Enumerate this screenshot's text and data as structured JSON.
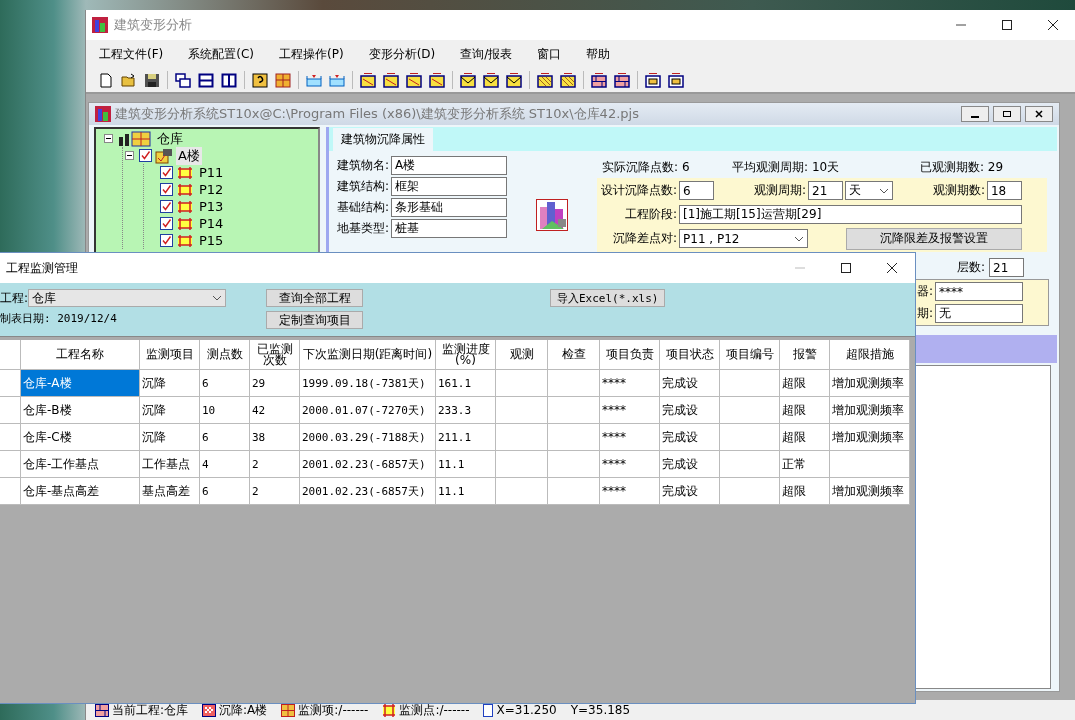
{
  "main_window": {
    "title": "建筑变形分析",
    "menu": [
      "工程文件(F)",
      "系统配置(C)",
      "工程操作(P)",
      "变形分析(D)",
      "查询/报表",
      "窗口",
      "帮助"
    ],
    "status_bar": [
      {
        "kind": "project",
        "text": "当前工程:仓库"
      },
      {
        "kind": "building",
        "text": "沉降:A楼"
      },
      {
        "kind": "item",
        "text": "监测项:/------"
      },
      {
        "kind": "point",
        "text": "监测点:/------"
      },
      {
        "kind": "coord",
        "text": "X=31.250"
      },
      {
        "kind": "none",
        "text": "Y=35.185"
      }
    ]
  },
  "child_window": {
    "title": "建筑变形分析系统ST10x@C:\\Program Files (x86)\\建筑变形分析系统 ST10x\\仓库42.pjs",
    "tree": {
      "label": "仓库",
      "expanded": true,
      "selected": false,
      "children": [
        {
          "label": "A楼",
          "checked": true,
          "expanded": true,
          "selected": true,
          "children": [
            {
              "label": "P11",
              "checked": true,
              "selected": false
            },
            {
              "label": "P12",
              "checked": true,
              "selected": false
            },
            {
              "label": "P13",
              "checked": true,
              "selected": false
            },
            {
              "label": "P14",
              "checked": true,
              "selected": false
            },
            {
              "label": "P15",
              "checked": true,
              "selected": false
            }
          ]
        }
      ]
    },
    "tab": {
      "label": "建筑物沉降属性",
      "selected": true
    },
    "fields": [
      {
        "label": "建筑物名:",
        "value": "A楼"
      },
      {
        "label": "建筑结构:",
        "value": "框架"
      },
      {
        "label": "基础结构:",
        "value": "条形基础"
      },
      {
        "label": "地基类型:",
        "value": "桩基"
      }
    ],
    "stats": [
      {
        "label": "实际沉降点数:",
        "value": "6"
      },
      {
        "label": "平均观测周期:",
        "value": "10天"
      },
      {
        "label": "已观测期数:",
        "value": "29"
      }
    ],
    "design_points": {
      "label": "设计沉降点数:",
      "value": "6"
    },
    "period": {
      "label": "观测周期:",
      "value": "21",
      "unit": "天"
    },
    "period_count": {
      "label": "观测期数:",
      "value": "18"
    },
    "stage": {
      "label": "工程阶段:",
      "value": "[1]施工期[15]运营期[29]"
    },
    "pair": {
      "label": "沉降差点对:",
      "value": "P11 , P12"
    },
    "alarm_button": "沉降限差及报警设置",
    "floors": {
      "label": "层数:",
      "value": "21"
    },
    "partial_fields": [
      {
        "label": "器:",
        "value": "****"
      },
      {
        "label": "期:",
        "value": "无"
      }
    ]
  },
  "dialog": {
    "title": "工程监测管理",
    "project": {
      "label": "工程:",
      "value": "仓库"
    },
    "date": "制表日期: 2019/12/4",
    "buttons": [
      "查询全部工程",
      "定制查询项目",
      "导入Excel(*.xls)"
    ],
    "table": {
      "columns": [
        "工程名称",
        "监测项目",
        "测点数",
        "已监测次数",
        "下次监测日期(距离时间)",
        "监测进度(%)",
        "观测",
        "检查",
        "项目负责",
        "项目状态",
        "项目编号",
        "报警",
        "超限措施"
      ],
      "rows": [
        {
          "selected": true,
          "cells": [
            "仓库-A楼",
            "沉降",
            "6",
            "29",
            "1999.09.18(-7381天)",
            "161.1",
            "",
            "",
            "****",
            "完成设",
            "",
            "超限",
            "增加观测频率"
          ]
        },
        {
          "selected": false,
          "cells": [
            "仓库-B楼",
            "沉降",
            "10",
            "42",
            "2000.01.07(-7270天)",
            "233.3",
            "",
            "",
            "****",
            "完成设",
            "",
            "超限",
            "增加观测频率"
          ]
        },
        {
          "selected": false,
          "cells": [
            "仓库-C楼",
            "沉降",
            "6",
            "38",
            "2000.03.29(-7188天)",
            "211.1",
            "",
            "",
            "****",
            "完成设",
            "",
            "超限",
            "增加观测频率"
          ]
        },
        {
          "selected": false,
          "cells": [
            "仓库-工作基点",
            "工作基点",
            "4",
            "2",
            "2001.02.23(-6857天)",
            "11.1",
            "",
            "",
            "****",
            "完成设",
            "",
            "正常",
            ""
          ]
        },
        {
          "selected": false,
          "cells": [
            "仓库-基点高差",
            "基点高差",
            "6",
            "2",
            "2001.02.23(-6857天)",
            "11.1",
            "",
            "",
            "****",
            "完成设",
            "",
            "超限",
            "增加观测频率"
          ]
        }
      ]
    }
  }
}
